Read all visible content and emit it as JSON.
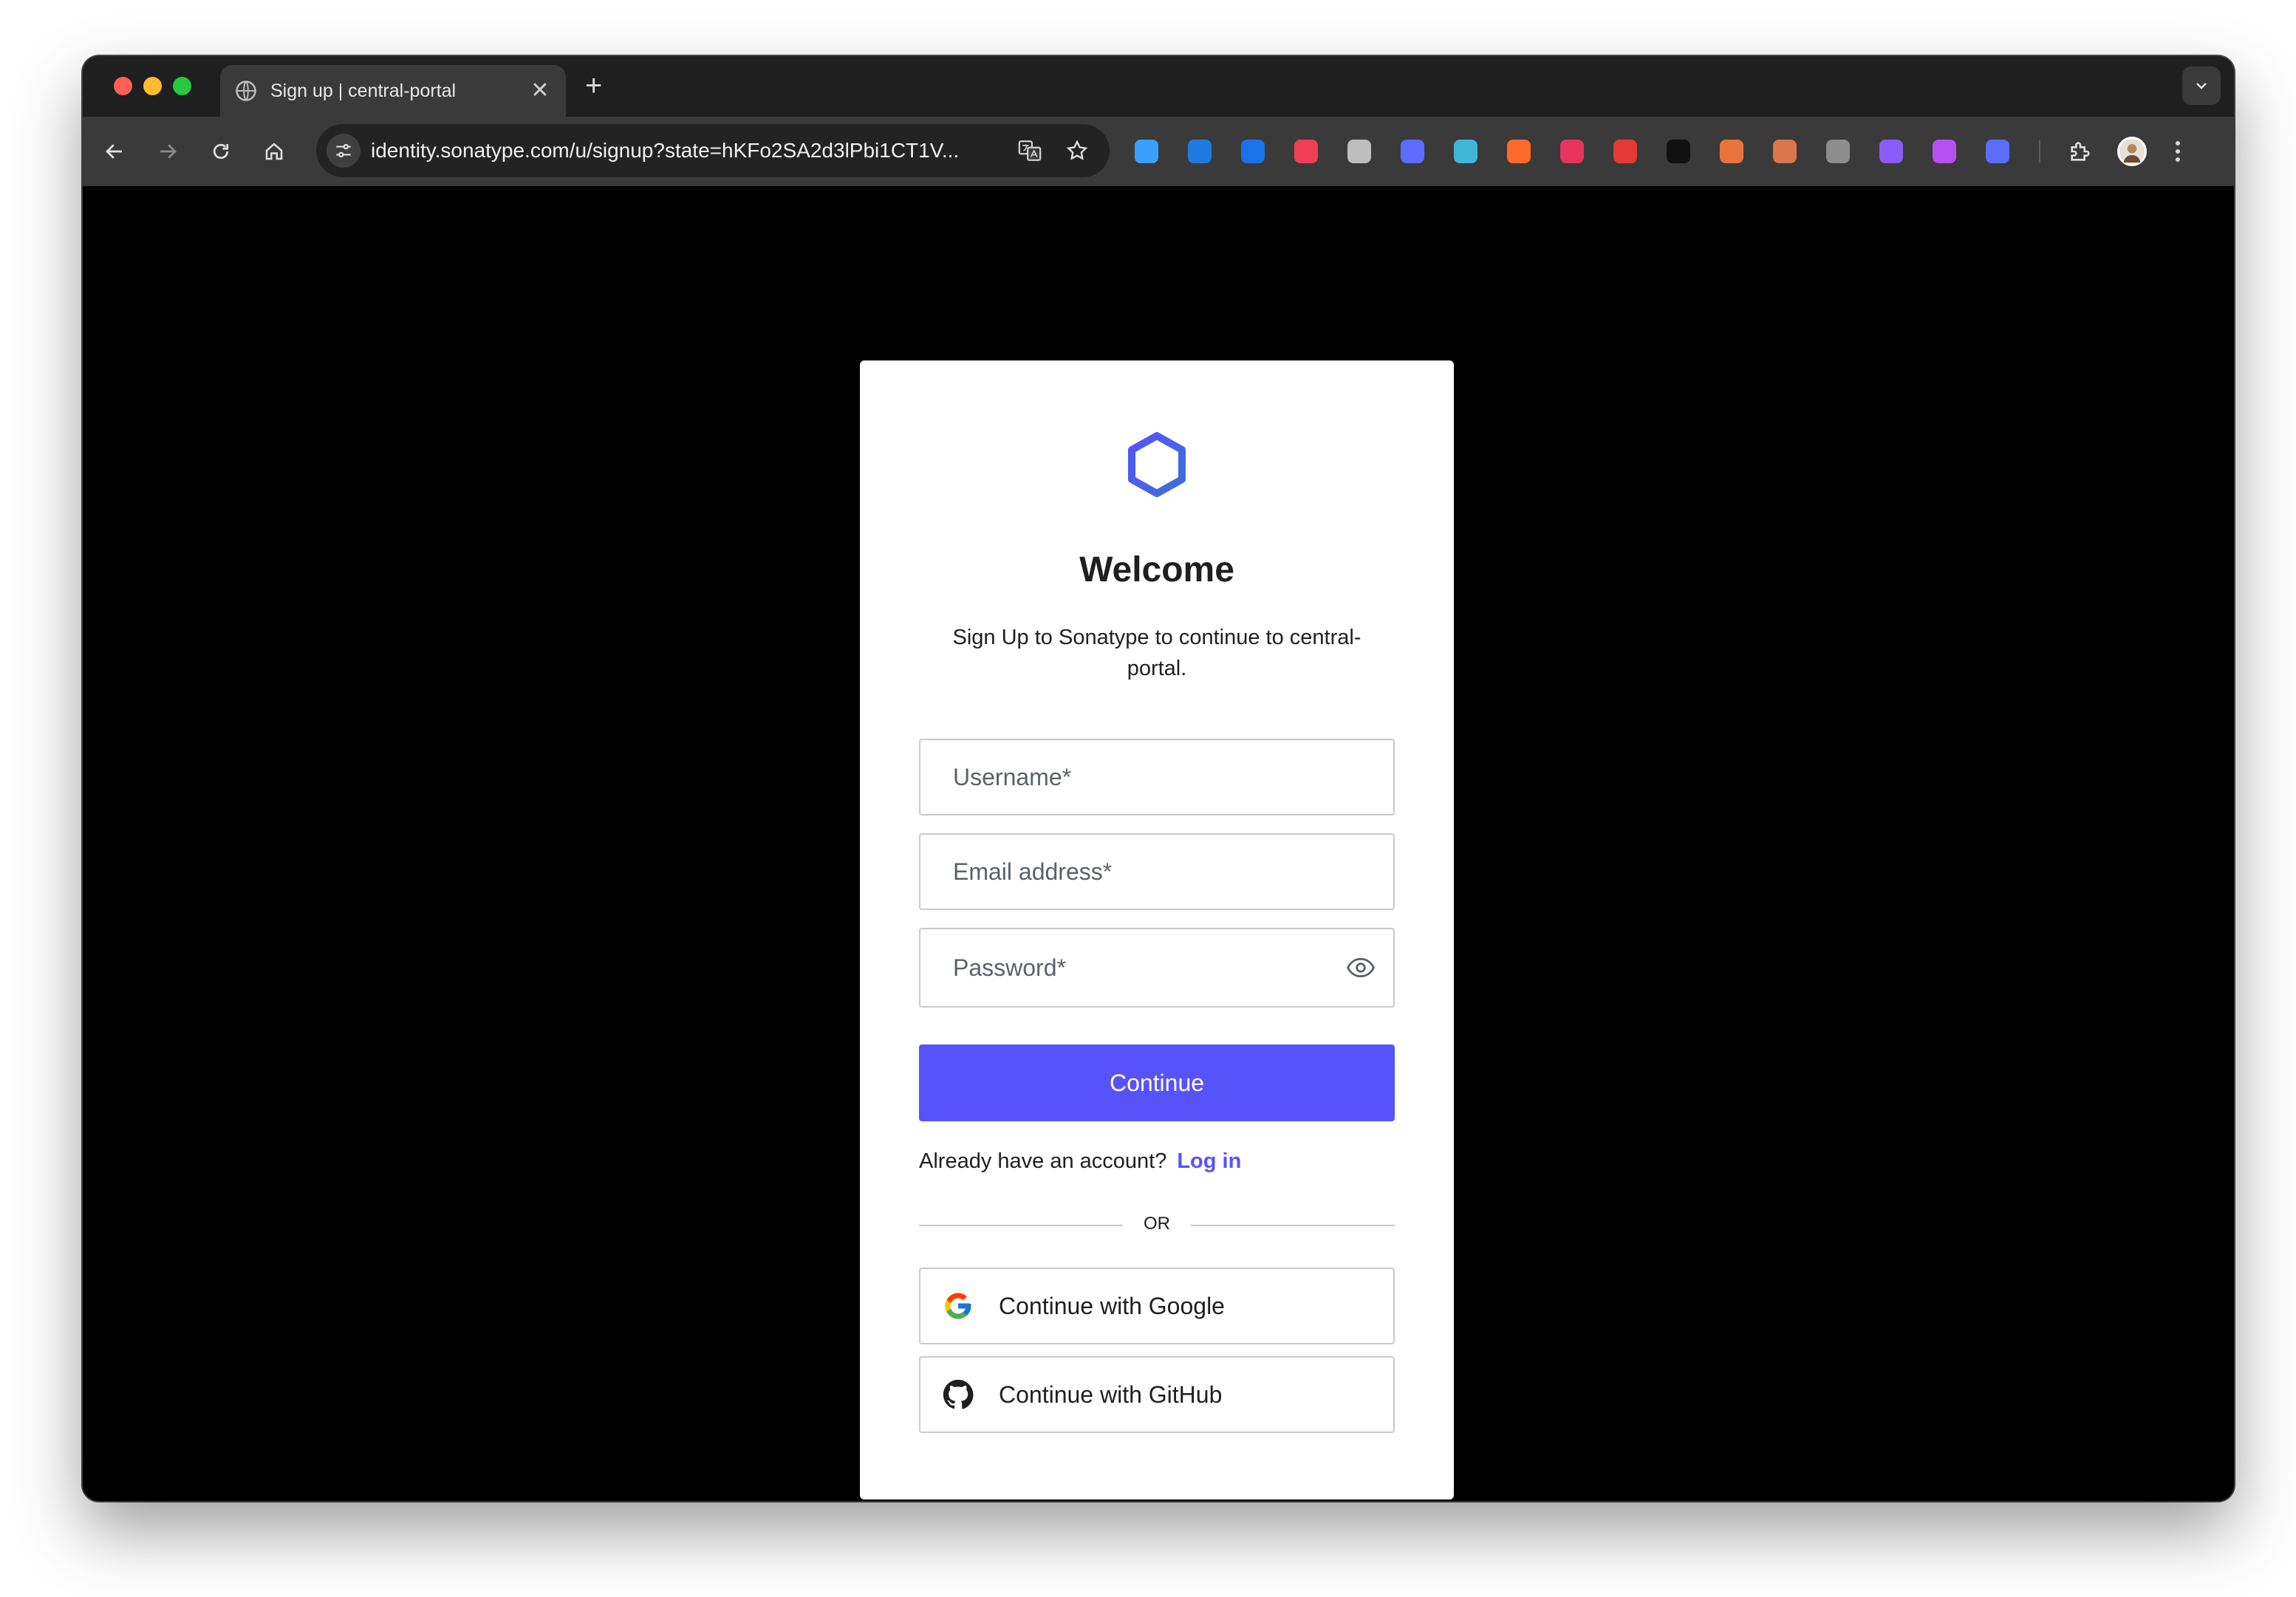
{
  "browser": {
    "tab_title": "Sign up | central-portal",
    "tab_close": "✕",
    "new_tab": "+",
    "url": "identity.sonatype.com/u/signup?state=hKFo2SA2d3lPbi1CT1V...",
    "extension_colors": [
      "#3aa0ff",
      "#1f7ae0",
      "#1a73e8",
      "#ef3e56",
      "#bdbdbd",
      "#5b6cff",
      "#3fb6d8",
      "#ff6a2a",
      "#e8345f",
      "#e53935",
      "#111111",
      "#e8743b",
      "#d9774b",
      "#8d8d8d",
      "#8a5cf6",
      "#b84ff0",
      "#5b6cff"
    ]
  },
  "signup": {
    "heading": "Welcome",
    "subtext": "Sign Up to Sonatype to continue to central-portal.",
    "username_placeholder": "Username*",
    "email_placeholder": "Email address*",
    "password_placeholder": "Password*",
    "continue_label": "Continue",
    "login_prompt": "Already have an account?",
    "login_link": "Log in",
    "divider": "OR",
    "google_label": "Continue with Google",
    "github_label": "Continue with GitHub"
  },
  "colors": {
    "accent": "#5753fb",
    "logo_start": "#5753fb",
    "logo_end": "#3b6fd9"
  }
}
